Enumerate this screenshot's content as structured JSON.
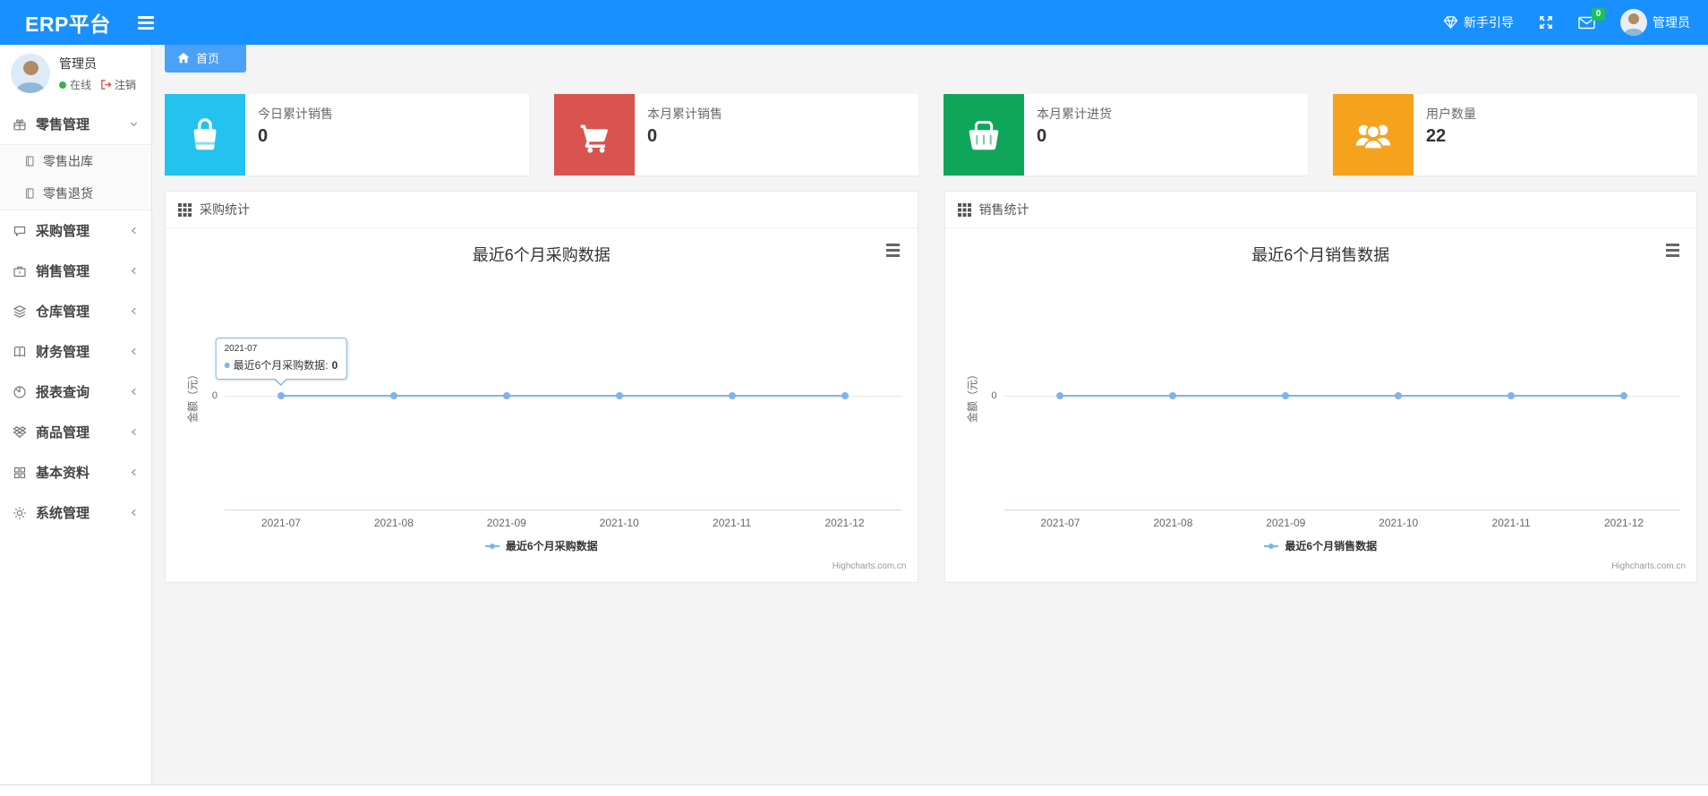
{
  "header": {
    "brand": "ERP平台",
    "guide_label": "新手引导",
    "mail_badge": "0",
    "user_name": "管理员"
  },
  "sidebar": {
    "user": {
      "name": "管理员",
      "status": "在线",
      "logout_label": "注销"
    },
    "items": [
      {
        "label": "零售管理"
      },
      {
        "label": "采购管理"
      },
      {
        "label": "销售管理"
      },
      {
        "label": "仓库管理"
      },
      {
        "label": "财务管理"
      },
      {
        "label": "报表查询"
      },
      {
        "label": "商品管理"
      },
      {
        "label": "基本资料"
      },
      {
        "label": "系统管理"
      }
    ],
    "retail_children": [
      {
        "label": "零售出库"
      },
      {
        "label": "零售退货"
      }
    ]
  },
  "tabbar": {
    "home": "首页"
  },
  "cards": [
    {
      "title": "今日累计销售",
      "value": "0",
      "color": "#23c2ef"
    },
    {
      "title": "本月累计销售",
      "value": "0",
      "color": "#d9534f"
    },
    {
      "title": "本月累计进货",
      "value": "0",
      "color": "#0fa65a"
    },
    {
      "title": "用户数量",
      "value": "22",
      "color": "#f5a21d"
    }
  ],
  "panels": [
    {
      "title": "采购统计"
    },
    {
      "title": "销售统计"
    }
  ],
  "chart_data": [
    {
      "type": "line",
      "title": "最近6个月采购数据",
      "categories": [
        "2021-07",
        "2021-08",
        "2021-09",
        "2021-10",
        "2021-11",
        "2021-12"
      ],
      "series": [
        {
          "name": "最近6个月采购数据",
          "values": [
            0,
            0,
            0,
            0,
            0,
            0
          ]
        }
      ],
      "xlabel": "",
      "ylabel": "金额（元）",
      "ytick": "0",
      "ylim": [
        0,
        1
      ],
      "grid": true,
      "line_color": "#7cb5ec",
      "legend_position": "bottom",
      "credits": "Highcharts.com.cn",
      "tooltip": {
        "visible": true,
        "point_index": 0,
        "header": "2021-07",
        "series": "最近6个月采购数据",
        "separator": ": ",
        "value": "0"
      }
    },
    {
      "type": "line",
      "title": "最近6个月销售数据",
      "categories": [
        "2021-07",
        "2021-08",
        "2021-09",
        "2021-10",
        "2021-11",
        "2021-12"
      ],
      "series": [
        {
          "name": "最近6个月销售数据",
          "values": [
            0,
            0,
            0,
            0,
            0,
            0
          ]
        }
      ],
      "xlabel": "",
      "ylabel": "金额（元）",
      "ytick": "0",
      "ylim": [
        0,
        1
      ],
      "grid": true,
      "line_color": "#7cb5ec",
      "legend_position": "bottom",
      "credits": "Highcharts.com.cn",
      "tooltip": {
        "visible": false
      }
    }
  ]
}
